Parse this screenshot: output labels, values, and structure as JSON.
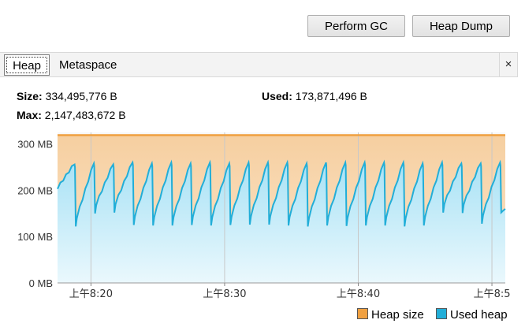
{
  "toolbar": {
    "perform_gc_label": "Perform GC",
    "heap_dump_label": "Heap Dump"
  },
  "tabs": {
    "items": [
      {
        "label": "Heap",
        "selected": true
      },
      {
        "label": "Metaspace",
        "selected": false
      }
    ],
    "close_glyph": "×"
  },
  "heap_info": {
    "size_label": "Size:",
    "size_value": "334,495,776 B",
    "used_label": "Used:",
    "used_value": "173,871,496 B",
    "max_label": "Max:",
    "max_value": "2,147,483,672 B"
  },
  "chart_data": {
    "type": "area",
    "y_tick_labels": [
      "0 MB",
      "100 MB",
      "200 MB",
      "300 MB"
    ],
    "y_ticks": [
      0,
      100,
      200,
      300
    ],
    "ylim": [
      0,
      325
    ],
    "x_tick_labels": [
      "上午8:20",
      "上午8:30",
      "上午8:40",
      "上午8:5"
    ],
    "x_ticks_minutes": [
      20,
      30,
      40,
      50
    ],
    "xlim_minutes": [
      17.5,
      51.0
    ],
    "heap_size_mb": 319,
    "used_heap_sawtooth": {
      "low_mb": [
        122,
        150,
        152,
        125,
        124,
        124,
        125,
        124,
        125,
        126,
        126,
        124,
        122,
        124,
        123,
        124,
        124,
        122,
        124,
        152,
        151,
        128,
        152
      ],
      "peak_mb": [
        258,
        260,
        258,
        262,
        260,
        262,
        260,
        262,
        260,
        262,
        262,
        262,
        260,
        262,
        262,
        262,
        262,
        262,
        260,
        262,
        260,
        260,
        262
      ],
      "start_mb": 205,
      "end_mb": 160
    },
    "grid": true,
    "legend_position": "bottom-right",
    "legend": [
      {
        "name": "Heap size",
        "color": "#f0a040"
      },
      {
        "name": "Used heap",
        "color": "#22aed8"
      }
    ]
  }
}
